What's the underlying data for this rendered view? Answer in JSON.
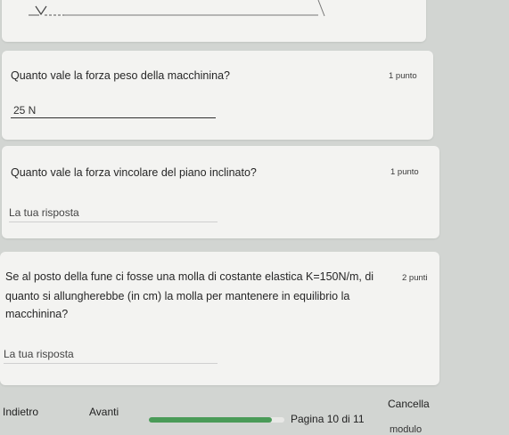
{
  "q1": {
    "title": "Quanto vale la forza peso della macchinina?",
    "points": "1 punto",
    "answer": "25 N"
  },
  "q2": {
    "title": "Quanto vale la forza vincolare del piano inclinato?",
    "points": "1 punto",
    "placeholder": "La tua risposta"
  },
  "q3": {
    "line1": "Se al posto della fune ci fosse una molla di costante elastica K=150N/m, di",
    "line2": "quanto si allungherebbe (in cm) la molla per mantenere in equilibrio la",
    "line3": "macchinina?",
    "points": "2 punti",
    "placeholder": "La tua risposta"
  },
  "nav": {
    "back_label": "Indietro",
    "next_label": "Avanti",
    "cancel_label": "Cancella",
    "page_label": "Pagina 10 di 11",
    "progress": 0.91
  },
  "footer": {
    "text": "modulo"
  },
  "colors": {
    "progress": "#4a9b58",
    "background": "#d2d5d2",
    "card": "#f3f3f1"
  }
}
